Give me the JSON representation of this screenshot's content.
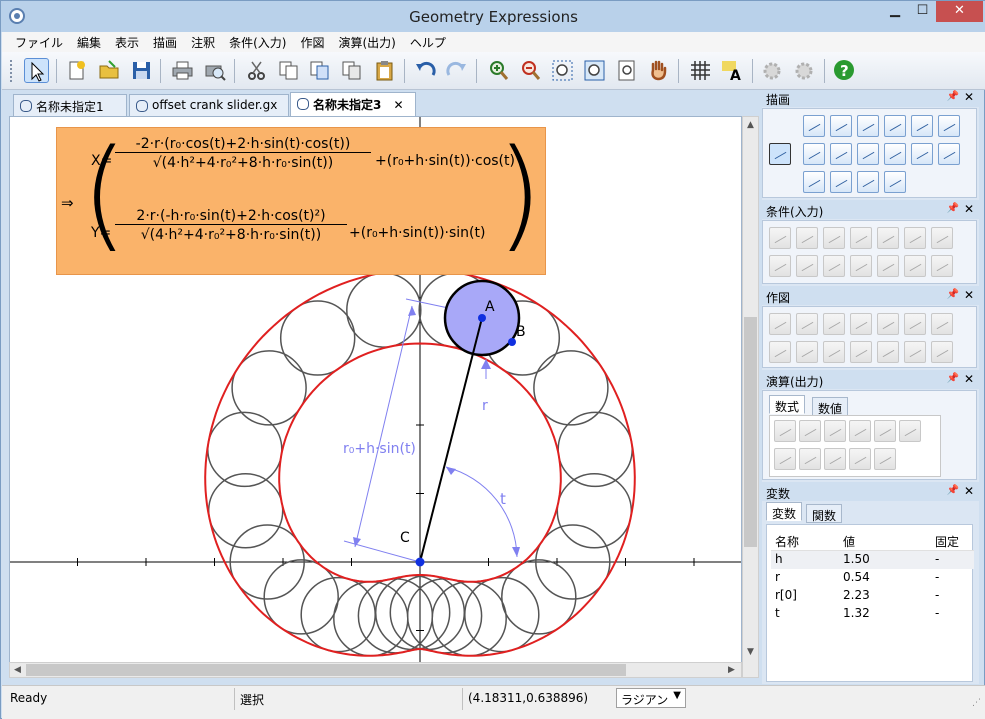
{
  "window": {
    "title": "Geometry Expressions",
    "min_label": "▁",
    "max_label": "☐",
    "close_label": "✕"
  },
  "menu": [
    "ファイル",
    "編集",
    "表示",
    "描画",
    "注釈",
    "条件(入力)",
    "作図",
    "演算(出力)",
    "ヘルプ"
  ],
  "tabs": [
    {
      "label": "名称未指定1",
      "active": false
    },
    {
      "label": "offset crank slider.gx",
      "active": false
    },
    {
      "label": "名称未指定3",
      "active": true,
      "close": "✕"
    }
  ],
  "formula": {
    "implies": "⇒",
    "x_lhs": "X=",
    "x_num": "-2·r·(r₀·cos(t)+2·h·sin(t)·cos(t))",
    "x_den": "√(4·h²+4·r₀²+8·h·r₀·sin(t))",
    "x_rest": "+(r₀+h·sin(t))·cos(t)",
    "y_lhs": "Y=",
    "y_num": "2·r·(-h·r₀·sin(t)+2·h·cos(t)²)",
    "y_den": "√(4·h²+4·r₀²+8·h·r₀·sin(t))",
    "y_rest": "+(r₀+h·sin(t))·sin(t)"
  },
  "canvas_labels": {
    "point_a": "A",
    "point_b": "B",
    "point_c": "C",
    "label_r": "r",
    "label_t": "t",
    "label_len": "r₀+h·sin(t)"
  },
  "panels": {
    "draw": "描画",
    "constrain": "条件(入力)",
    "construct": "作図",
    "calculate": "演算(出力)",
    "variables": "変数",
    "pin": "📌",
    "close": "✕"
  },
  "calc_tabs": [
    "数式",
    "数値"
  ],
  "var_tabs": [
    "変数",
    "関数"
  ],
  "variables": {
    "headers": {
      "name": "名称",
      "value": "値",
      "fixed": "固定"
    },
    "rows": [
      {
        "name": "h",
        "value": "1.50",
        "fixed": "-"
      },
      {
        "name": "r",
        "value": "0.54",
        "fixed": "-"
      },
      {
        "name": "r[0]",
        "value": "2.23",
        "fixed": "-"
      },
      {
        "name": "t",
        "value": "1.32",
        "fixed": "-"
      }
    ]
  },
  "status": {
    "ready": "Ready",
    "mode": "選択",
    "coords": "(4.18311,0.638896)",
    "angle_unit": "ラジアン"
  },
  "colors": {
    "formula_bg": "#fab36a",
    "locus": "#e02020",
    "construction": "#8080f0",
    "circle_fill": "#a8a8f8",
    "point": "#1030e0"
  }
}
